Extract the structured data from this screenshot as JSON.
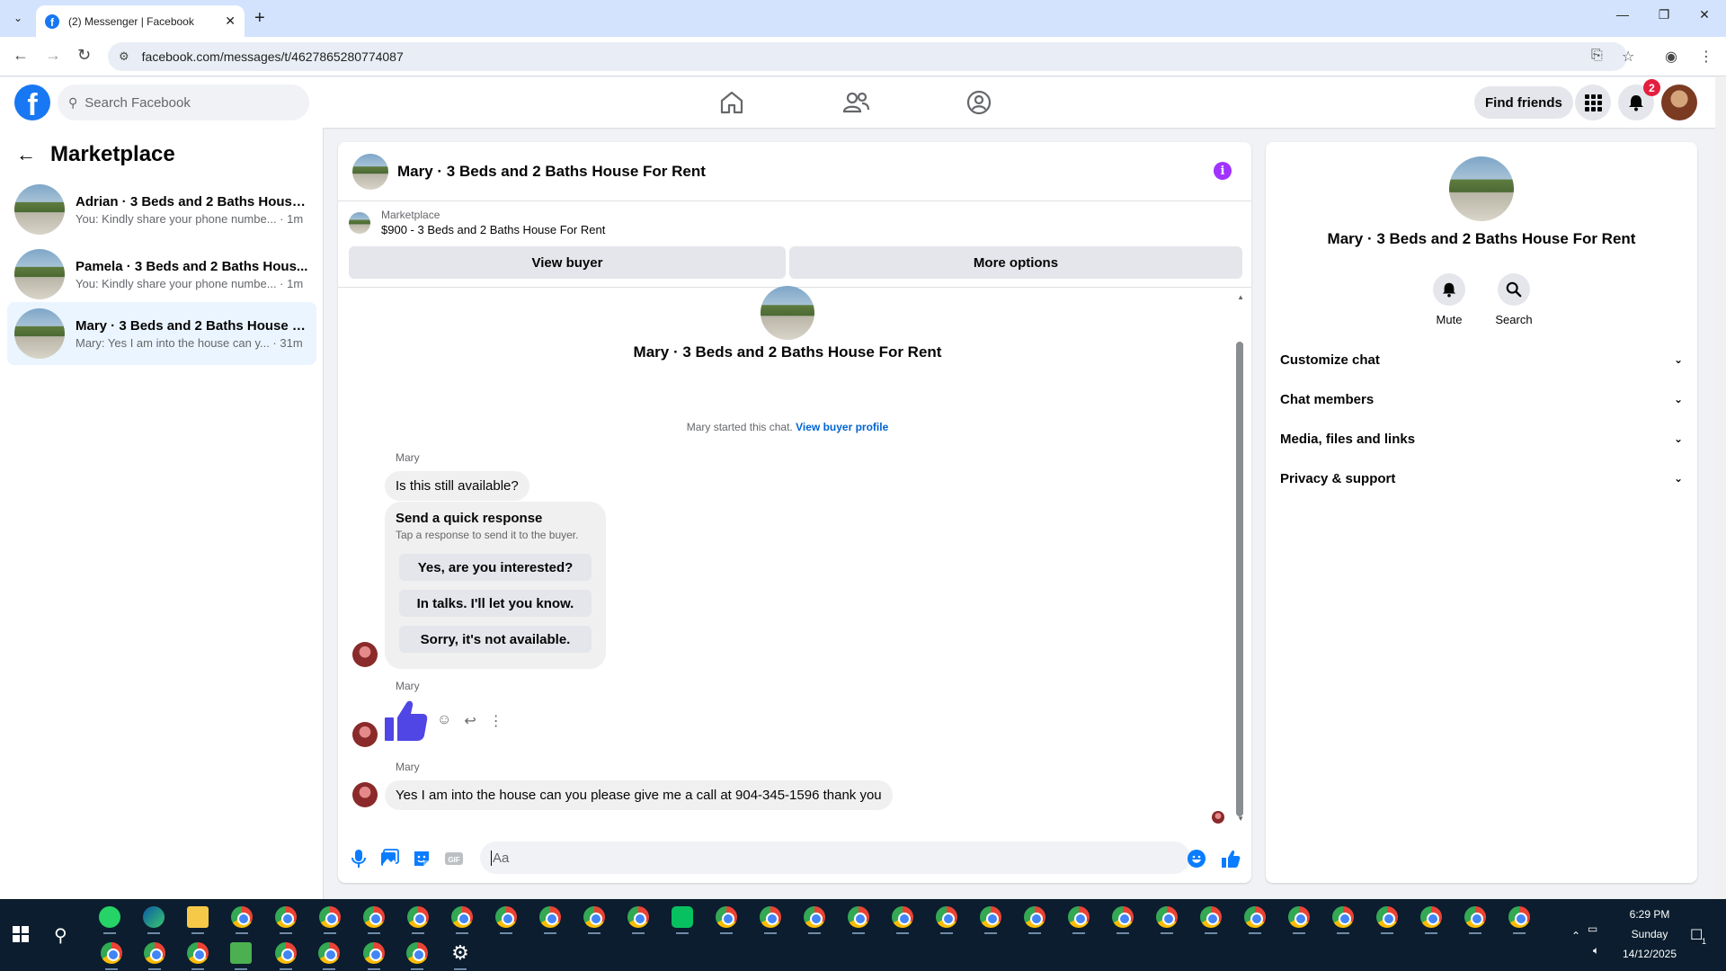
{
  "browser": {
    "tab_title": "(2) Messenger | Facebook",
    "url": "facebook.com/messages/t/4627865280774087"
  },
  "header": {
    "search_placeholder": "Search Facebook",
    "find_friends": "Find friends",
    "notifications_count": "2"
  },
  "sidebar": {
    "title": "Marketplace",
    "conversations": [
      {
        "name": "Adrian · 3 Beds and 2 Baths House...",
        "preview": "You: Kindly share your phone numbe... · 1m"
      },
      {
        "name": "Pamela · 3 Beds and 2 Baths Hous...",
        "preview": "You: Kindly share your phone numbe... · 1m"
      },
      {
        "name": "Mary · 3 Beds and 2 Baths House F...",
        "preview": "Mary: Yes I am into the house can y... · 31m"
      }
    ]
  },
  "chat": {
    "title": "Mary · 3 Beds and 2 Baths House For Rent",
    "marketplace_label": "Marketplace",
    "listing": "$900 - 3 Beds and 2 Baths House For Rent",
    "view_buyer": "View buyer",
    "more_options": "More options",
    "center_title": "Mary · 3 Beds and 2 Baths House For Rent",
    "started_text": "Mary started this chat.",
    "view_buyer_profile": "View buyer profile",
    "sender": "Mary",
    "msg1": "Is this still available?",
    "quick_title": "Send a quick response",
    "quick_sub": "Tap a response to send it to the buyer.",
    "quick_replies": [
      "Yes, are you interested?",
      "In talks. I'll let you know.",
      "Sorry, it's not available."
    ],
    "msg3": "Yes I am into the house can you please give me a call at 904-345-1596 thank you",
    "composer_placeholder": "Aa"
  },
  "details": {
    "title": "Mary · 3 Beds and 2 Baths House For Rent",
    "mute": "Mute",
    "search": "Search",
    "sections": [
      "Customize chat",
      "Chat members",
      "Media, files and links",
      "Privacy & support"
    ]
  },
  "taskbar": {
    "time": "6:29 PM",
    "day": "Sunday",
    "date": "14/12/2025",
    "notification_count": "1"
  }
}
